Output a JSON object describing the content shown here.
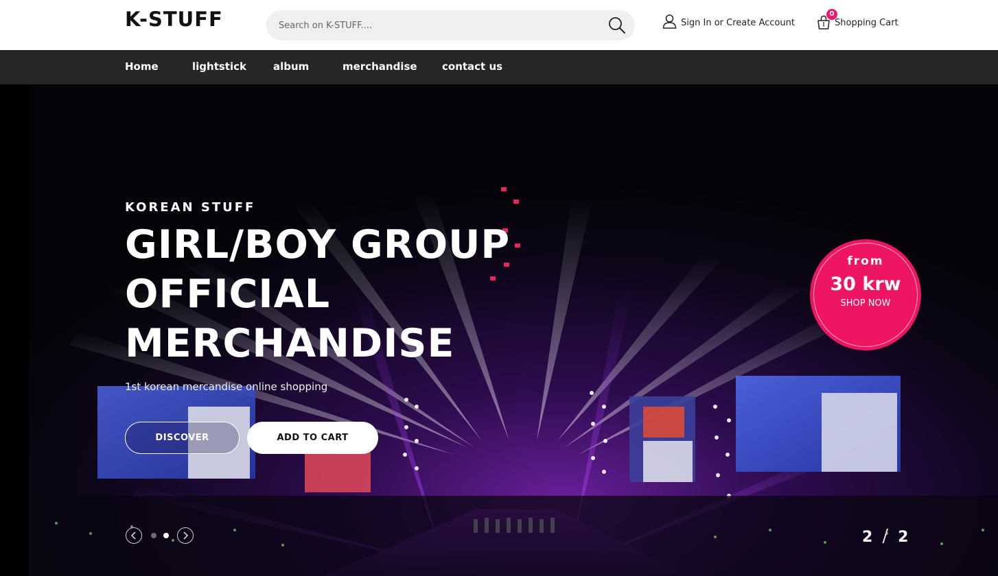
{
  "brand": {
    "logo": "K-STUFF"
  },
  "search": {
    "placeholder": "Search on K-STUFF...."
  },
  "account": {
    "label": "Sign In or Create Account"
  },
  "cart": {
    "label": "Shopping Cart",
    "count": "0"
  },
  "nav": {
    "items": [
      {
        "label": "Home"
      },
      {
        "label": "lightstick"
      },
      {
        "label": "album"
      },
      {
        "label": "merchandise"
      },
      {
        "label": "contact us"
      }
    ]
  },
  "hero": {
    "eyebrow": "KOREAN STUFF",
    "headline_lines": [
      "GIRL/BOY GROUP",
      "OFFICIAL",
      "MERCHANDISE"
    ],
    "subline": "1st korean mercandise online shopping",
    "discover_label": "DISCOVER",
    "add_to_cart_label": "ADD TO CART",
    "promo": {
      "from": "from",
      "price": "30 krw",
      "cta": "SHOP NOW"
    },
    "slider": {
      "current": "2",
      "total": "2",
      "active_dot": 2
    }
  },
  "colors": {
    "accent": "#ee1663",
    "nav_bg": "#262626",
    "search_bg": "#efefef"
  },
  "icons": {
    "search": "search-icon",
    "user": "user-icon",
    "cart": "shopping-bag-icon",
    "prev": "chevron-left-icon",
    "next": "chevron-right-icon"
  }
}
